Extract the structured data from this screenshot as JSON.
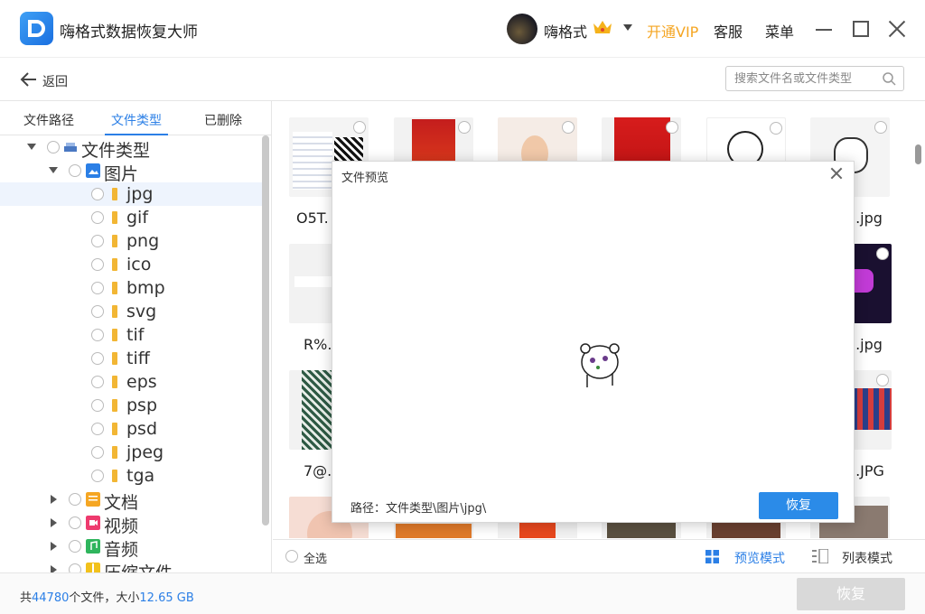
{
  "app": {
    "title": "嗨格式数据恢复大师",
    "username": "嗨格式",
    "vip_label": "开通VIP",
    "service_label": "客服",
    "menu_label": "菜单"
  },
  "toolbar": {
    "back_label": "返回",
    "search_placeholder": "搜索文件名或文件类型"
  },
  "tabs": [
    {
      "label": "文件路径"
    },
    {
      "label": "文件类型"
    },
    {
      "label": "已删除"
    }
  ],
  "tree": {
    "root": "文件类型",
    "images": "图片",
    "exts": [
      "jpg",
      "gif",
      "png",
      "ico",
      "bmp",
      "svg",
      "tif",
      "tiff",
      "eps",
      "psp",
      "psd",
      "jpeg",
      "tga"
    ],
    "documents": "文档",
    "videos": "视频",
    "audio": "音频",
    "archives": "压缩文件"
  },
  "grid": {
    "row1": [
      "O5T.",
      "..jpg"
    ],
    "row2": [
      "R%.",
      "..jpg"
    ],
    "row3": [
      "7@.",
      "..JPG"
    ]
  },
  "modal": {
    "title": "文件预览",
    "path": "路径：文件类型\\图片\\jpg\\",
    "recover_label": "恢复"
  },
  "gridbar": {
    "select_all": "全选",
    "preview_mode": "预览模式",
    "list_mode": "列表模式"
  },
  "status": {
    "prefix": "共",
    "file_count": "44780",
    "mid": "个文件，大小",
    "size": "12.65 GB",
    "recover_label": "恢复"
  },
  "colors": {
    "accent": "#2b7fe6",
    "vip": "#f5a623",
    "disabled_button": "#d9d9d9"
  }
}
